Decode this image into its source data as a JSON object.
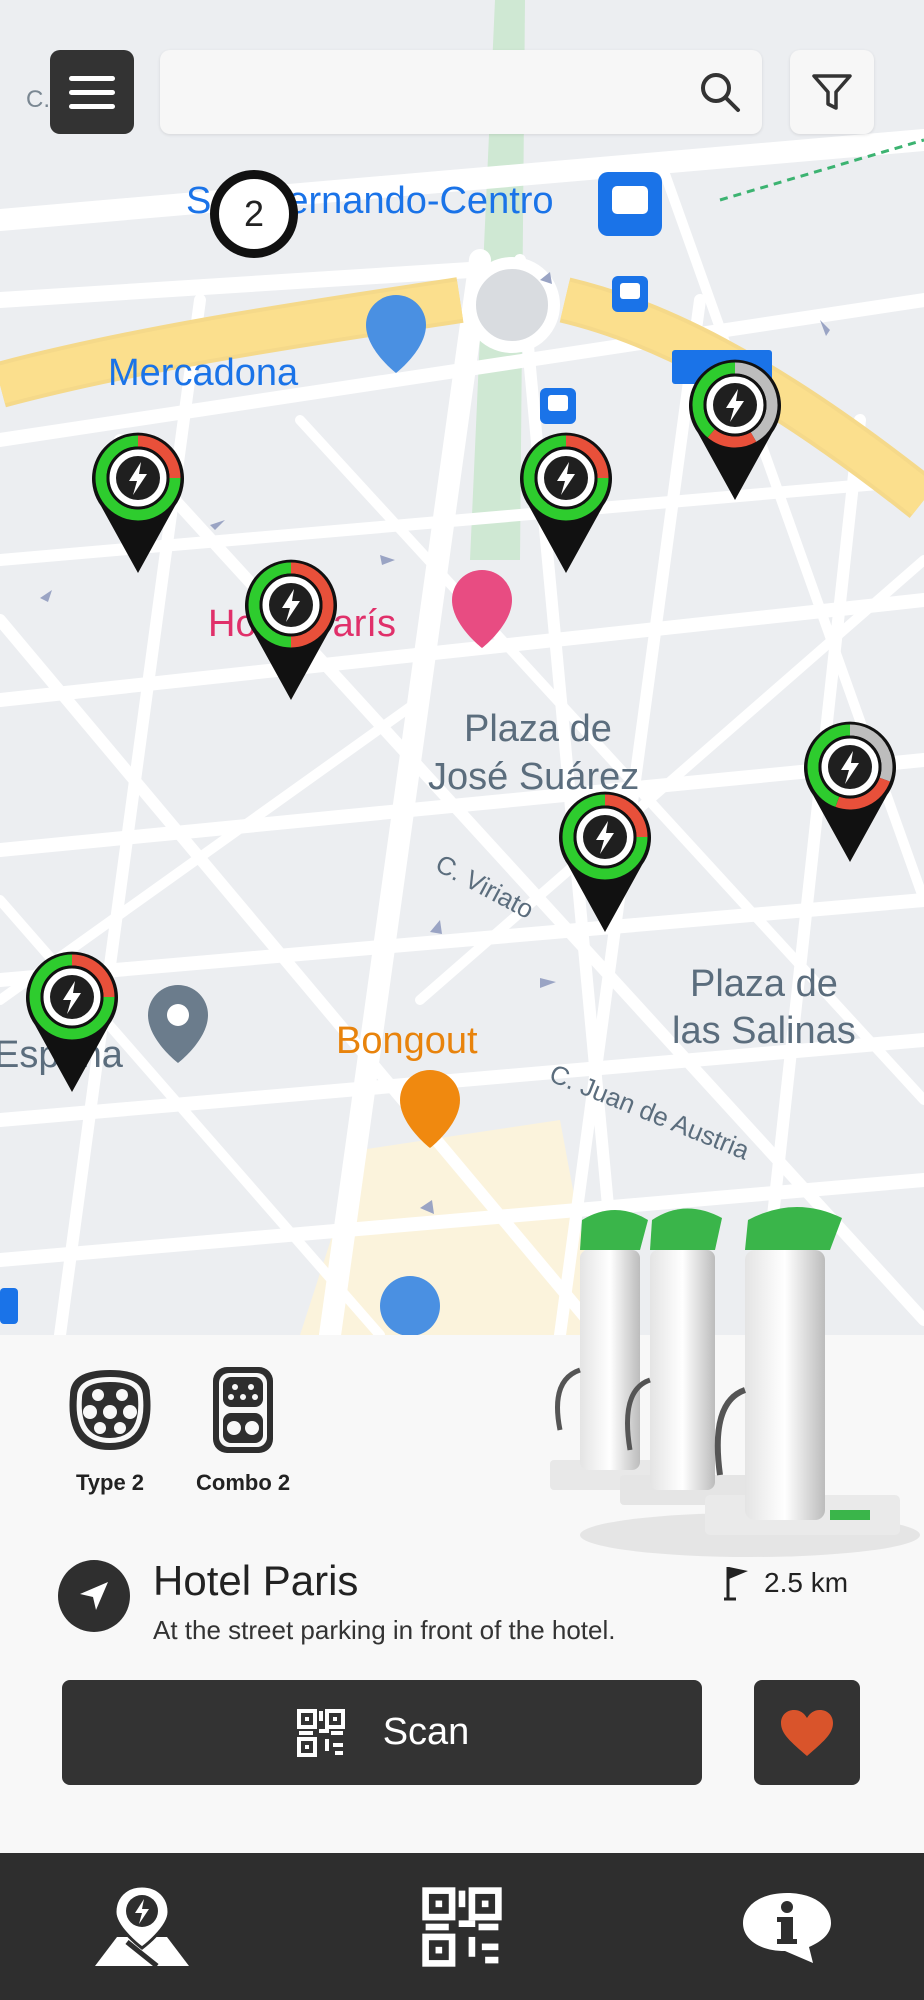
{
  "search": {
    "placeholder": ""
  },
  "map": {
    "cluster_count": "2",
    "labels": {
      "station_area": "San Fernando-Centro",
      "mercadona": "Mercadona",
      "hotel": "Hotel París",
      "plaza_jose_1": "Plaza de",
      "plaza_jose_2": "José Suárez",
      "viriato": "C. Viriato",
      "plaza_salinas_1": "Plaza de",
      "plaza_salinas_2": "las Salinas",
      "bongout": "Bongout",
      "juan_austria": "C. Juan de Austria",
      "espana": "España",
      "cfer": "C.  Fe"
    }
  },
  "connectors": [
    {
      "label": "Type 2",
      "icon": "type2-connector-icon"
    },
    {
      "label": "Combo 2",
      "icon": "combo2-connector-icon"
    }
  ],
  "station": {
    "name": "Hotel Paris",
    "description": "At the street parking in front of the hotel.",
    "distance": "2.5 km"
  },
  "actions": {
    "scan_label": "Scan"
  },
  "nav": [
    "map-pin-icon",
    "qr-code-icon",
    "info-icon"
  ],
  "colors": {
    "available": "#2ecc2e",
    "occupied": "#e8503a",
    "offline": "#bdbdbd",
    "dark": "#333333",
    "heart": "#d9542b"
  }
}
